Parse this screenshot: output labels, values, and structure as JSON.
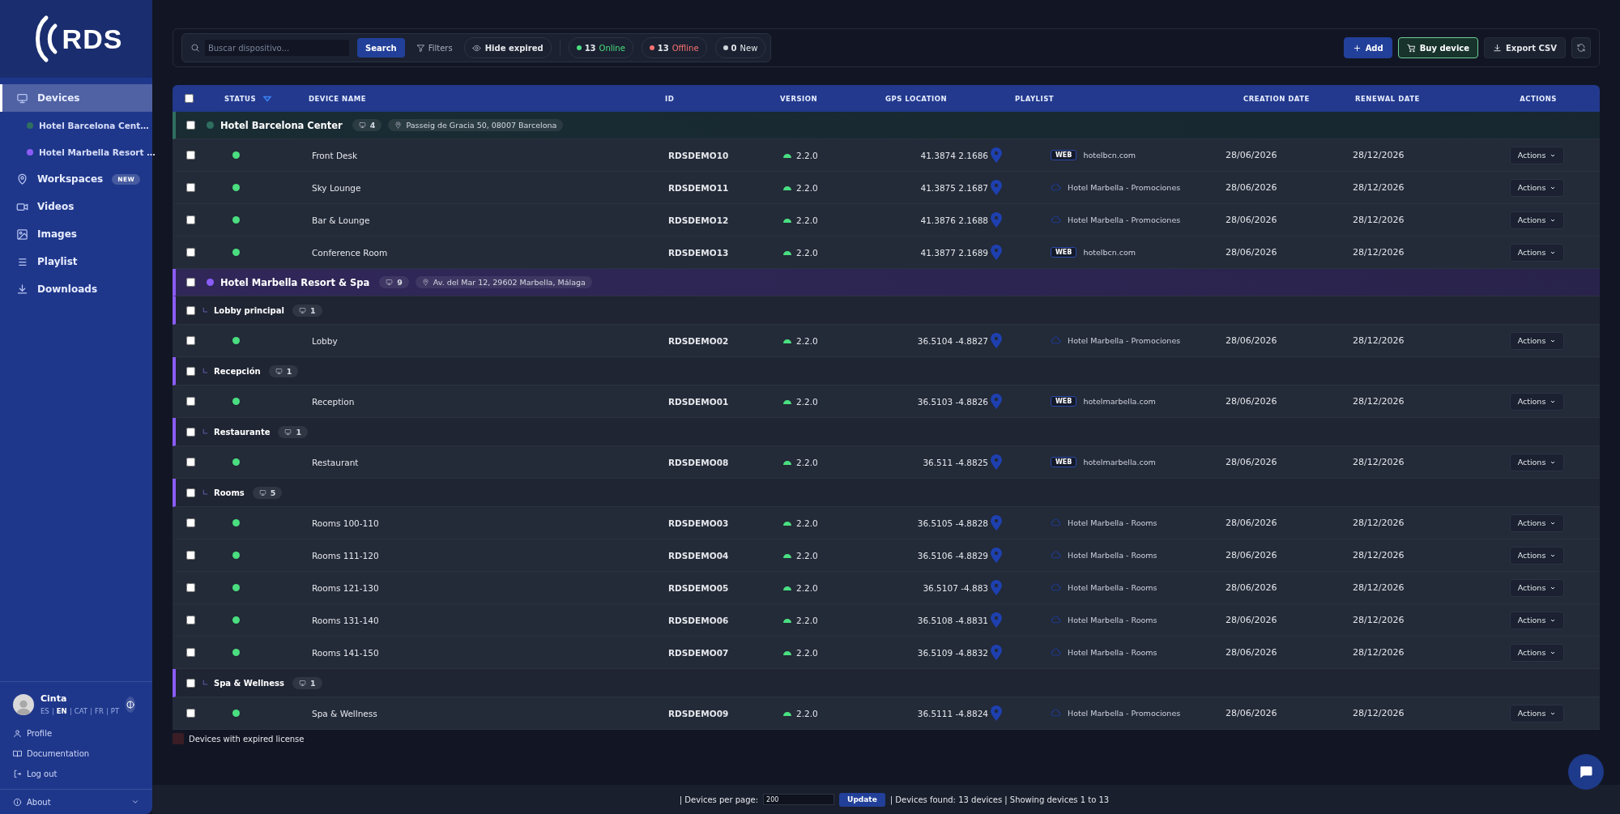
{
  "sidebar": {
    "logo": "RDS",
    "nav": [
      {
        "label": "Devices",
        "selected": true,
        "children": [
          {
            "label": "Hotel Barcelona Cent…",
            "color": "#2f6f60",
            "selected": false
          },
          {
            "label": "Hotel Marbella Resort …",
            "color": "#8b5cf6",
            "selected": false
          }
        ]
      },
      {
        "label": "Workspaces",
        "badge": "NEW",
        "selected": false
      },
      {
        "label": "Videos",
        "selected": false
      },
      {
        "label": "Images",
        "selected": false
      },
      {
        "label": "Playlist",
        "selected": false
      },
      {
        "label": "Downloads",
        "selected": false
      }
    ],
    "user": {
      "name": "Cinta",
      "languages": [
        {
          "code": "ES",
          "selected": false
        },
        {
          "code": "EN",
          "selected": true
        },
        {
          "code": "CAT",
          "selected": false
        },
        {
          "code": "FR",
          "selected": false
        },
        {
          "code": "PT",
          "selected": false
        }
      ]
    },
    "links": [
      "Profile",
      "Documentation",
      "Log out"
    ],
    "about": "About"
  },
  "toolbar": {
    "search": {
      "placeholder": "Buscar dispositivo..."
    },
    "search_button": "Search",
    "filters": "Filters",
    "hide_expired": "Hide expired",
    "counters": [
      {
        "kind": "online",
        "count": "13",
        "label": "Online"
      },
      {
        "kind": "offline",
        "count": "13",
        "label": "Offline"
      },
      {
        "kind": "new",
        "count": "0",
        "label": "New"
      }
    ],
    "actions": [
      {
        "kind": "primary",
        "label": "Add"
      },
      {
        "kind": "buy",
        "label": "Buy device"
      },
      {
        "kind": "export",
        "label": "Export CSV"
      }
    ]
  },
  "table": {
    "select_all": {
      "checked": false
    },
    "columns": [
      "STATUS",
      "DEVICE NAME",
      "ID",
      "VERSION",
      "GPS LOCATION",
      "PLAYLIST",
      "CREATION DATE",
      "RENEWAL DATE",
      "ACTIONS"
    ],
    "groups": [
      {
        "name": "Hotel Barcelona Center",
        "color": "#2f6f60",
        "checked": false,
        "count": "4",
        "address": "Passeig de Gracia 50, 08007 Barcelona",
        "devices": [
          {
            "checked": false,
            "online": true,
            "name": "Front Desk",
            "id": "RDSDEMO10",
            "version": "2.2.0",
            "gps": "41.3874 2.1686",
            "playlist": {
              "kind": "web",
              "badge": "WEB",
              "label": "hotelbcn.com"
            },
            "created": "28/06/2026",
            "renewal": "28/12/2026",
            "action": "Actions"
          },
          {
            "checked": false,
            "online": true,
            "name": "Sky Lounge",
            "id": "RDSDEMO11",
            "version": "2.2.0",
            "gps": "41.3875 2.1687",
            "playlist": {
              "kind": "cloud",
              "label": "Hotel Marbella - Promociones"
            },
            "created": "28/06/2026",
            "renewal": "28/12/2026",
            "action": "Actions"
          },
          {
            "checked": false,
            "online": true,
            "name": "Bar & Lounge",
            "id": "RDSDEMO12",
            "version": "2.2.0",
            "gps": "41.3876 2.1688",
            "playlist": {
              "kind": "cloud",
              "label": "Hotel Marbella - Promociones"
            },
            "created": "28/06/2026",
            "renewal": "28/12/2026",
            "action": "Actions"
          },
          {
            "checked": false,
            "online": true,
            "name": "Conference Room",
            "id": "RDSDEMO13",
            "version": "2.2.0",
            "gps": "41.3877 2.1689",
            "playlist": {
              "kind": "web",
              "badge": "WEB",
              "label": "hotelbcn.com"
            },
            "created": "28/06/2026",
            "renewal": "28/12/2026",
            "action": "Actions"
          }
        ]
      },
      {
        "name": "Hotel Marbella Resort & Spa",
        "color": "#8b5cf6",
        "checked": false,
        "count": "9",
        "address": "Av. del Mar 12, 29602 Marbella, Málaga",
        "subgroups": [
          {
            "name": "Lobby principal",
            "checked": false,
            "count": "1",
            "devices": [
              {
                "checked": false,
                "online": true,
                "name": "Lobby",
                "id": "RDSDEMO02",
                "version": "2.2.0",
                "gps": "36.5104 -4.8827",
                "playlist": {
                  "kind": "cloud",
                  "label": "Hotel Marbella - Promociones"
                },
                "created": "28/06/2026",
                "renewal": "28/12/2026",
                "action": "Actions"
              }
            ]
          },
          {
            "name": "Recepción",
            "checked": false,
            "count": "1",
            "devices": [
              {
                "checked": false,
                "online": true,
                "name": "Reception",
                "id": "RDSDEMO01",
                "version": "2.2.0",
                "gps": "36.5103 -4.8826",
                "playlist": {
                  "kind": "web",
                  "badge": "WEB",
                  "label": "hotelmarbella.com"
                },
                "created": "28/06/2026",
                "renewal": "28/12/2026",
                "action": "Actions"
              }
            ]
          },
          {
            "name": "Restaurante",
            "checked": false,
            "count": "1",
            "devices": [
              {
                "checked": false,
                "online": true,
                "name": "Restaurant",
                "id": "RDSDEMO08",
                "version": "2.2.0",
                "gps": "36.511 -4.8825",
                "playlist": {
                  "kind": "web",
                  "badge": "WEB",
                  "label": "hotelmarbella.com"
                },
                "created": "28/06/2026",
                "renewal": "28/12/2026",
                "action": "Actions"
              }
            ]
          },
          {
            "name": "Rooms",
            "checked": false,
            "count": "5",
            "devices": [
              {
                "checked": false,
                "online": true,
                "name": "Rooms 100-110",
                "id": "RDSDEMO03",
                "version": "2.2.0",
                "gps": "36.5105 -4.8828",
                "playlist": {
                  "kind": "cloud",
                  "label": "Hotel Marbella - Rooms"
                },
                "created": "28/06/2026",
                "renewal": "28/12/2026",
                "action": "Actions"
              },
              {
                "checked": false,
                "online": true,
                "name": "Rooms 111-120",
                "id": "RDSDEMO04",
                "version": "2.2.0",
                "gps": "36.5106 -4.8829",
                "playlist": {
                  "kind": "cloud",
                  "label": "Hotel Marbella - Rooms"
                },
                "created": "28/06/2026",
                "renewal": "28/12/2026",
                "action": "Actions"
              },
              {
                "checked": false,
                "online": true,
                "name": "Rooms 121-130",
                "id": "RDSDEMO05",
                "version": "2.2.0",
                "gps": "36.5107 -4.883",
                "playlist": {
                  "kind": "cloud",
                  "label": "Hotel Marbella - Rooms"
                },
                "created": "28/06/2026",
                "renewal": "28/12/2026",
                "action": "Actions"
              },
              {
                "checked": false,
                "online": true,
                "name": "Rooms 131-140",
                "id": "RDSDEMO06",
                "version": "2.2.0",
                "gps": "36.5108 -4.8831",
                "playlist": {
                  "kind": "cloud",
                  "label": "Hotel Marbella - Rooms"
                },
                "created": "28/06/2026",
                "renewal": "28/12/2026",
                "action": "Actions"
              },
              {
                "checked": false,
                "online": true,
                "name": "Rooms 141-150",
                "id": "RDSDEMO07",
                "version": "2.2.0",
                "gps": "36.5109 -4.8832",
                "playlist": {
                  "kind": "cloud",
                  "label": "Hotel Marbella - Rooms"
                },
                "created": "28/06/2026",
                "renewal": "28/12/2026",
                "action": "Actions"
              }
            ]
          },
          {
            "name": "Spa & Wellness",
            "checked": false,
            "count": "1",
            "devices": [
              {
                "checked": false,
                "online": true,
                "name": "Spa & Wellness",
                "id": "RDSDEMO09",
                "version": "2.2.0",
                "gps": "36.5111 -4.8824",
                "playlist": {
                  "kind": "cloud",
                  "label": "Hotel Marbella - Promociones"
                },
                "created": "28/06/2026",
                "renewal": "28/12/2026",
                "action": "Actions"
              }
            ]
          }
        ]
      }
    ]
  },
  "legend": {
    "label": "Devices with expired license"
  },
  "footer": {
    "per_page_label": "| Devices per page:",
    "per_page": "200",
    "update": "Update",
    "summary": "| Devices found: 13 devices | Showing devices 1 to 13"
  }
}
